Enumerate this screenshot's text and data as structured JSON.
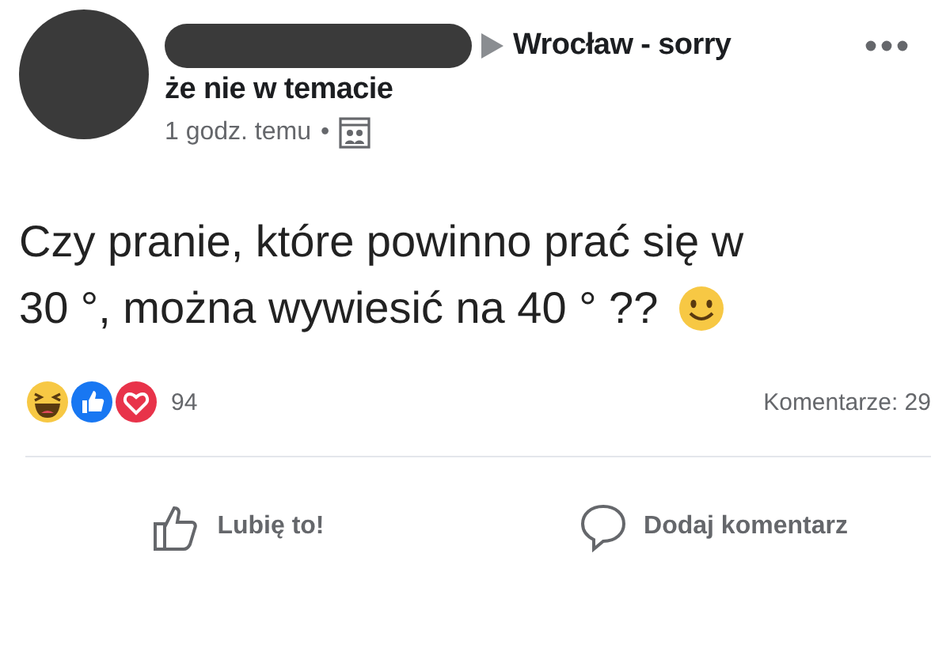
{
  "post": {
    "group_name_lines": [
      "Wrocław - sorry",
      "że nie w temacie"
    ],
    "time": "1 godz. temu",
    "separator": "•",
    "text_lines": [
      "Czy pranie, które powinno prać się w",
      "30 °, można wywiesić na 40 ° ??"
    ],
    "reactions_count": "94",
    "comments_count": "Komentarze: 29",
    "actions": [
      {
        "kind": "like",
        "label": "Lubię to!"
      },
      {
        "kind": "comment",
        "label": "Dodaj komentarz"
      }
    ]
  }
}
